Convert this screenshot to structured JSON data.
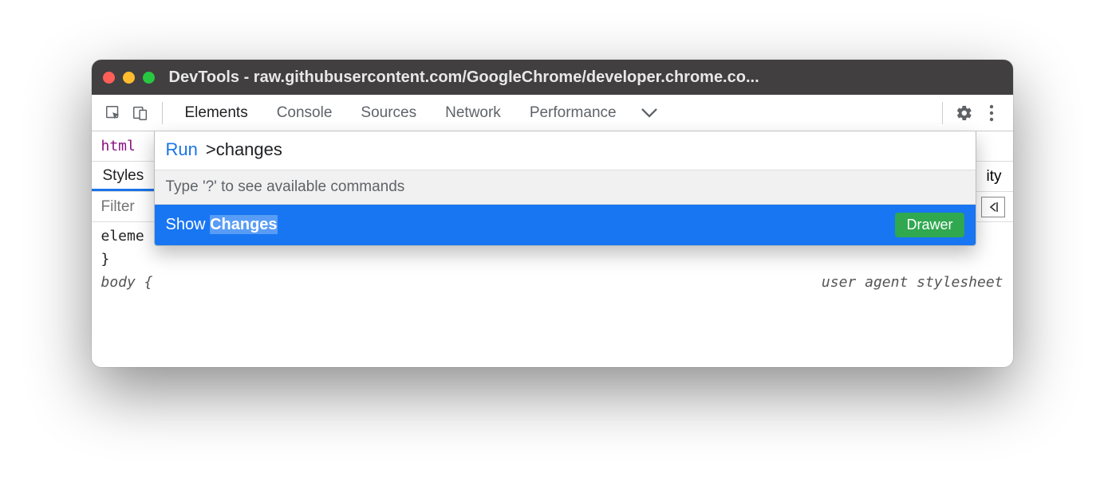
{
  "window": {
    "title": "DevTools - raw.githubusercontent.com/GoogleChrome/developer.chrome.co..."
  },
  "toolbar": {
    "tabs": [
      "Elements",
      "Console",
      "Sources",
      "Network",
      "Performance"
    ],
    "active_tab": "Elements"
  },
  "elements": {
    "selected_tag": "html"
  },
  "styles": {
    "tabs_left": "Styles",
    "tabs_right_fragment": "ity",
    "filter_placeholder": "Filter",
    "code_line1_left": "eleme",
    "code_line1_right": "",
    "code_line2": "}",
    "code_line3_left": "body {",
    "code_line3_right": "user agent stylesheet"
  },
  "command_menu": {
    "prefix": "Run",
    "input": ">changes",
    "hint": "Type '?' to see available commands",
    "item_prefix": "Show ",
    "item_highlight": "Changes",
    "badge": "Drawer"
  }
}
